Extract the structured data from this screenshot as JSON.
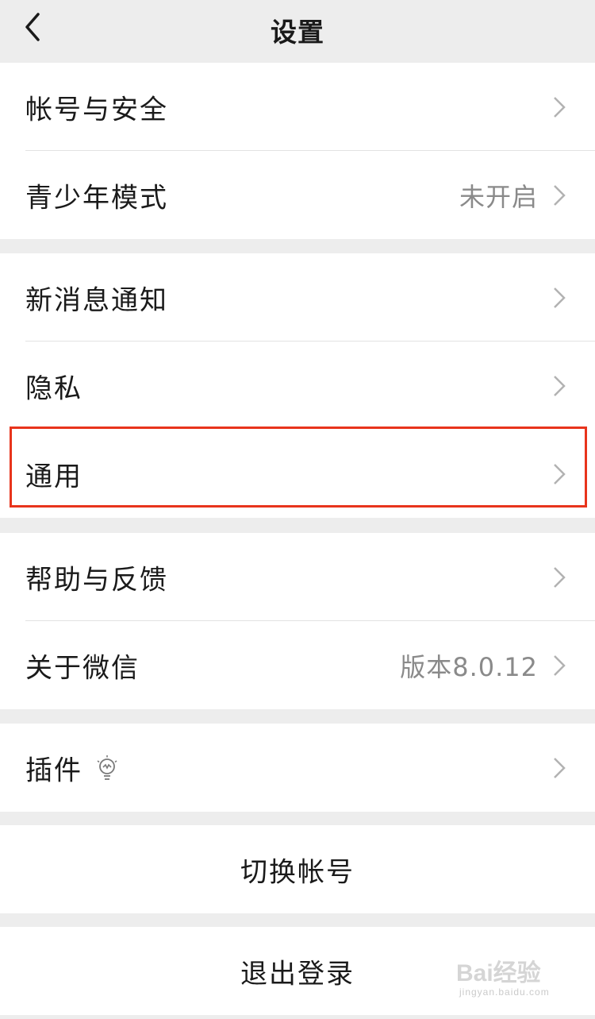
{
  "navbar": {
    "title": "设置",
    "back_icon": "chevron-left-icon"
  },
  "groups": [
    {
      "items": [
        {
          "name": "account-security",
          "label": "帐号与安全",
          "value": ""
        },
        {
          "name": "teen-mode",
          "label": "青少年模式",
          "value": "未开启"
        }
      ]
    },
    {
      "items": [
        {
          "name": "new-message-notification",
          "label": "新消息通知",
          "value": ""
        },
        {
          "name": "privacy",
          "label": "隐私",
          "value": ""
        },
        {
          "name": "general",
          "label": "通用",
          "value": "",
          "highlighted": true
        }
      ]
    },
    {
      "items": [
        {
          "name": "help-feedback",
          "label": "帮助与反馈",
          "value": ""
        },
        {
          "name": "about-wechat",
          "label": "关于微信",
          "value": "版本8.0.12"
        }
      ]
    },
    {
      "items": [
        {
          "name": "plugins",
          "label": "插件",
          "value": "",
          "icon": "lightbulb-icon"
        }
      ]
    }
  ],
  "actions": {
    "switch_account": "切换帐号",
    "logout": "退出登录"
  },
  "watermark": {
    "text": "Bai经验",
    "sub": "jingyan.baidu.com"
  },
  "colors": {
    "background": "#ededed",
    "highlight_border": "#e8341c",
    "value_text": "#8a8a8a"
  }
}
